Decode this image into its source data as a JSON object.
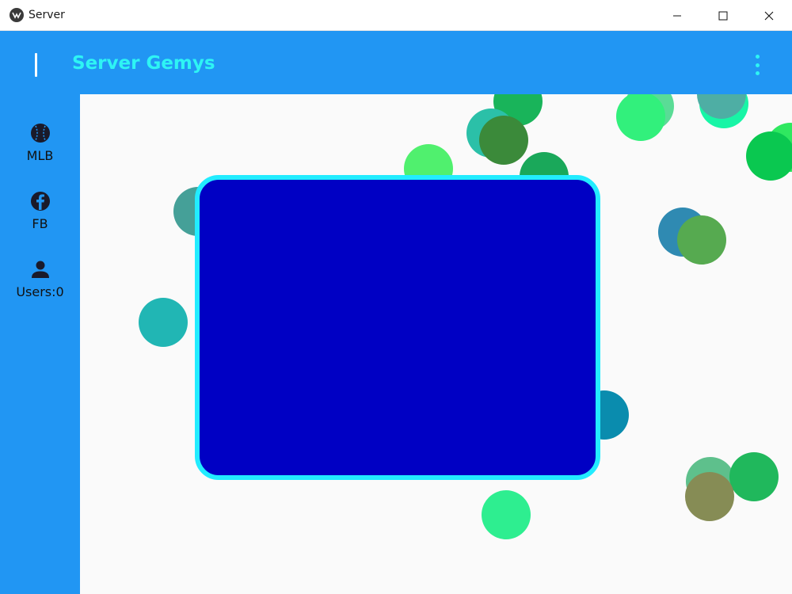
{
  "window": {
    "title": "Server",
    "icon": "kivy-logo-icon",
    "controls": [
      "minimize-icon",
      "maximize-icon",
      "close-icon"
    ]
  },
  "header": {
    "title": "Server Gemys",
    "title_color": "#2ef4f4",
    "menu_icon": "menu-bar-icon",
    "overflow_icon": "more-vertical-icon"
  },
  "sidebar": {
    "items": [
      {
        "label": "MLB",
        "icon": "baseball-icon"
      },
      {
        "label": "FB",
        "icon": "facebook-icon"
      },
      {
        "label": "Users:0",
        "icon": "user-icon"
      }
    ]
  },
  "colors": {
    "primary": "#2196f3",
    "panel": "#0000c4",
    "panel_border": "#22ecff",
    "background": "#fafafa"
  },
  "dots": [
    {
      "color": "#19b45a"
    },
    {
      "color": "#2bc0a8"
    },
    {
      "color": "#3b8a3a"
    },
    {
      "color": "#50f06e"
    },
    {
      "color": "#1aa85a"
    },
    {
      "color": "#45a098"
    },
    {
      "color": "#5adc96"
    },
    {
      "color": "#32f07c"
    },
    {
      "color": "#18f5a6"
    },
    {
      "color": "#4eaea4"
    },
    {
      "color": "#2fe860"
    },
    {
      "color": "#0ac850"
    },
    {
      "color": "#2f8ab2"
    },
    {
      "color": "#56aa50"
    },
    {
      "color": "#21b6b4"
    },
    {
      "color": "#0a8cae"
    },
    {
      "color": "#2eee90"
    },
    {
      "color": "#5ec08c"
    },
    {
      "color": "#20b85c"
    },
    {
      "color": "#868c55"
    }
  ]
}
